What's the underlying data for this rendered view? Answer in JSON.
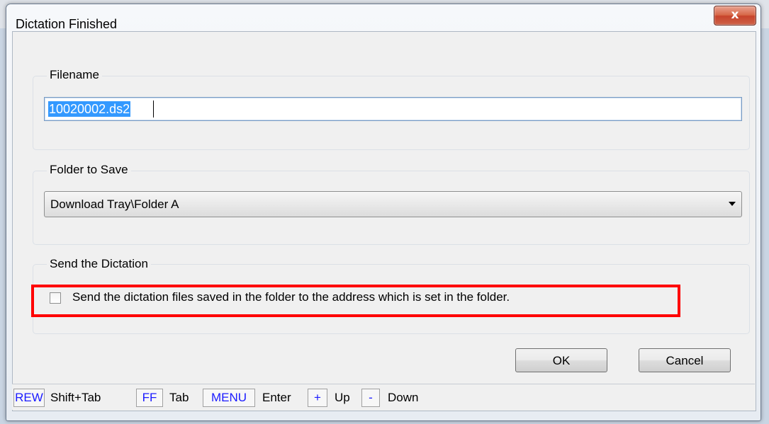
{
  "window": {
    "title": "Dictation Finished",
    "close_glyph": "x"
  },
  "filename_group": {
    "label": "Filename",
    "value": "10020002.ds2"
  },
  "folder_group": {
    "label": "Folder to Save",
    "selected": "Download Tray\\Folder A"
  },
  "send_group": {
    "label": "Send the Dictation",
    "checkbox_label": "Send the dictation files saved in the folder to the address which is set in the folder.",
    "checked": false
  },
  "buttons": {
    "ok": "OK",
    "cancel": "Cancel"
  },
  "shortcuts": [
    {
      "key": "REW",
      "action": "Shift+Tab"
    },
    {
      "key": "FF",
      "action": "Tab"
    },
    {
      "key": "MENU",
      "action": "Enter"
    },
    {
      "key": "+",
      "action": "Up"
    },
    {
      "key": "-",
      "action": "Down"
    }
  ],
  "colors": {
    "highlight": "#ff0000",
    "selection": "#3399ff",
    "key_text": "#1a1aff",
    "close_button": "#d76646"
  }
}
